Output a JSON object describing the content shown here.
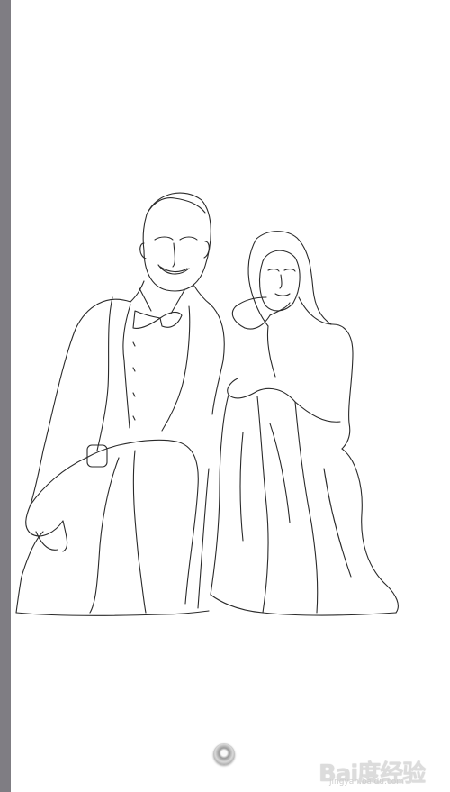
{
  "app": {
    "left_bar_color": "#7f7d83",
    "canvas_background": "#ffffff",
    "line_color": "#2a2a2a"
  },
  "canvas": {
    "content": "line-art sketch"
  },
  "controls": {
    "home_button_icon": "round-home-button"
  },
  "watermark": {
    "logo_text": "Bai度经验",
    "sub_text": "jingyan.baidu.com"
  }
}
